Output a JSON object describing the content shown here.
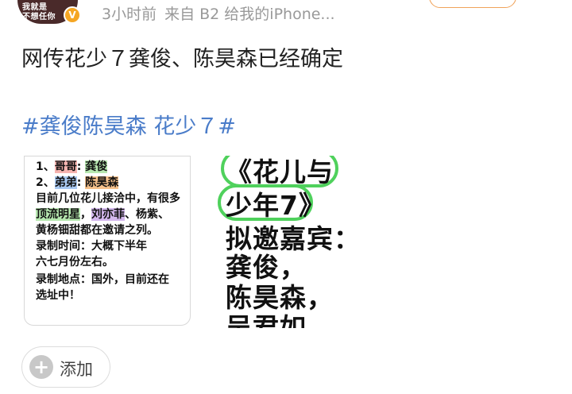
{
  "post": {
    "avatar_text_line1": "我就是",
    "avatar_text_line2": "不想任你",
    "time": "3小时前",
    "source": "来自 B2 给我的iPhone...",
    "text": "网传花少７龚俊、陈昊森已经确定",
    "hashtag": "#龚俊陈昊森 花少７#"
  },
  "image1": {
    "lines": [
      {
        "pre": "1、",
        "hl1": "哥哥",
        "mid": ": ",
        "hl2": "龚俊",
        "post": ""
      },
      {
        "pre": "2、",
        "hl1": "弟弟",
        "mid": ": ",
        "hl2": "陈昊森",
        "post": ""
      }
    ],
    "text3": "目前几位花儿接洽中，有很多",
    "text4_hl1": "顶流明星",
    "text4_mid": "，",
    "text4_hl2": "刘亦菲",
    "text4_post": "、杨紫、",
    "text5": "黄杨钿甜都在邀请之列。",
    "text6": "录制时间：大概下半年",
    "text7": "六七月份左右。",
    "text8": "录制地点：国外，目前还在",
    "text9": "选址中！"
  },
  "image2": {
    "line1": "《花儿与",
    "line2": "少年7》",
    "line3": "拟邀嘉宾：",
    "line4": "龚俊，",
    "line5": "陈昊森，",
    "line6": "吴君如"
  },
  "actions": {
    "add_label": "添加"
  },
  "colors": {
    "meta_gray": "#999999",
    "hashtag_blue": "#4a7cc9",
    "follow_orange": "#f0a35a",
    "highlight_green_circle": "#4fd15c"
  },
  "icons": {
    "verify": "verified-badge-icon",
    "add": "plus-circle-icon"
  }
}
